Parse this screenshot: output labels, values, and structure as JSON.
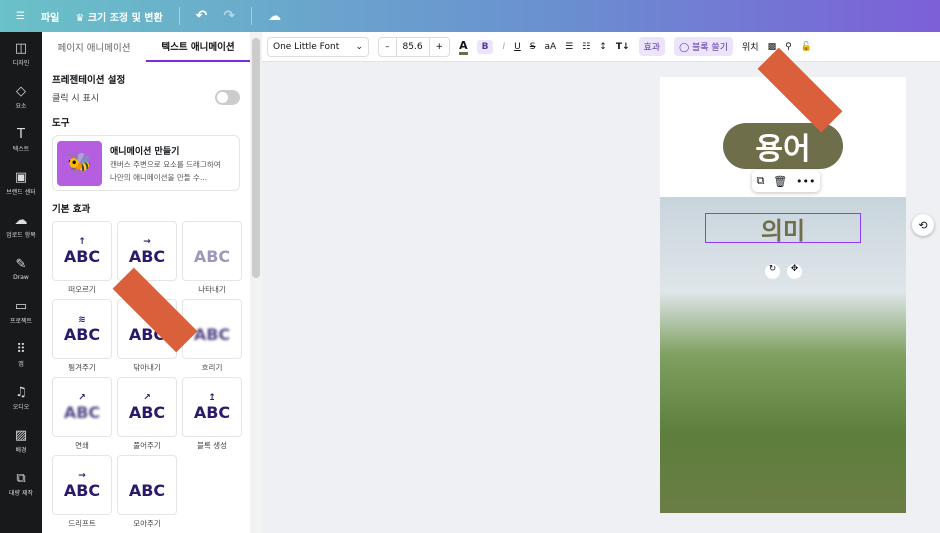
{
  "topbar": {
    "menu_icon": "☰",
    "file": "파일",
    "resize": "♛ 크기 조정 및 변환",
    "undo": "↶",
    "redo": "↷",
    "cloud": "☁"
  },
  "rail": [
    {
      "icon": "◫",
      "label": "디자인"
    },
    {
      "icon": "◇",
      "label": "요소"
    },
    {
      "icon": "T",
      "label": "텍스트"
    },
    {
      "icon": "▣",
      "label": "브랜드 센터"
    },
    {
      "icon": "☁",
      "label": "업로드 항목"
    },
    {
      "icon": "✎",
      "label": "Draw"
    },
    {
      "icon": "▭",
      "label": "프로젝트"
    },
    {
      "icon": "⠿",
      "label": "앱"
    },
    {
      "icon": "♫",
      "label": "오디오"
    },
    {
      "icon": "▨",
      "label": "배경"
    },
    {
      "icon": "⧉",
      "label": "대량 제작"
    }
  ],
  "panel": {
    "tabs": [
      "페이지 애니메이션",
      "텍스트 애니메이션"
    ],
    "presentation_heading": "프레젠테이션 설정",
    "click_show": "클릭 시 표시",
    "tools_heading": "도구",
    "tool": {
      "title": "애니메이션 만들기",
      "desc1": "캔버스 주변으로 요소를 드래그하여",
      "desc2": "나만의 애니메이션을 만들 수..."
    },
    "basic_heading": "기본 효과",
    "effects": [
      {
        "arrow": "↑",
        "label": "떠오르기"
      },
      {
        "arrow": "→",
        "label": ""
      },
      {
        "arrow": "",
        "label": "나타내기"
      },
      {
        "arrow": "≋",
        "label": "튕겨주기"
      },
      {
        "arrow": "",
        "label": "닦아내기"
      },
      {
        "arrow": "",
        "label": "흐리기"
      },
      {
        "arrow": "↗",
        "label": "연쇄"
      },
      {
        "arrow": "↗",
        "label": "풀어주기"
      },
      {
        "arrow": "↥",
        "label": "블록 생성"
      },
      {
        "arrow": "→",
        "label": "드리프트"
      },
      {
        "arrow": "",
        "label": "모아주기"
      }
    ],
    "abc": "ABC"
  },
  "toolbar": {
    "font": "One Little Font",
    "minus": "–",
    "size": "85.6",
    "plus": "+",
    "color": "A",
    "bold": "B",
    "italic": "I",
    "underline": "U",
    "strike": "S",
    "case": "aA",
    "align": "☰",
    "list": "☷",
    "spacing": "↕",
    "vertical": "T↓",
    "effects": "효과",
    "block": "◯ 블록 쓸기",
    "position": "위치",
    "transparency": "▩",
    "style": "⚲",
    "lock": "🔓"
  },
  "canvas": {
    "title": "용어",
    "subtitle": "의미",
    "ctx": [
      "⧉",
      "🗑",
      "•••"
    ],
    "rotate": "↻",
    "move": "✥",
    "comment": "⟲"
  }
}
